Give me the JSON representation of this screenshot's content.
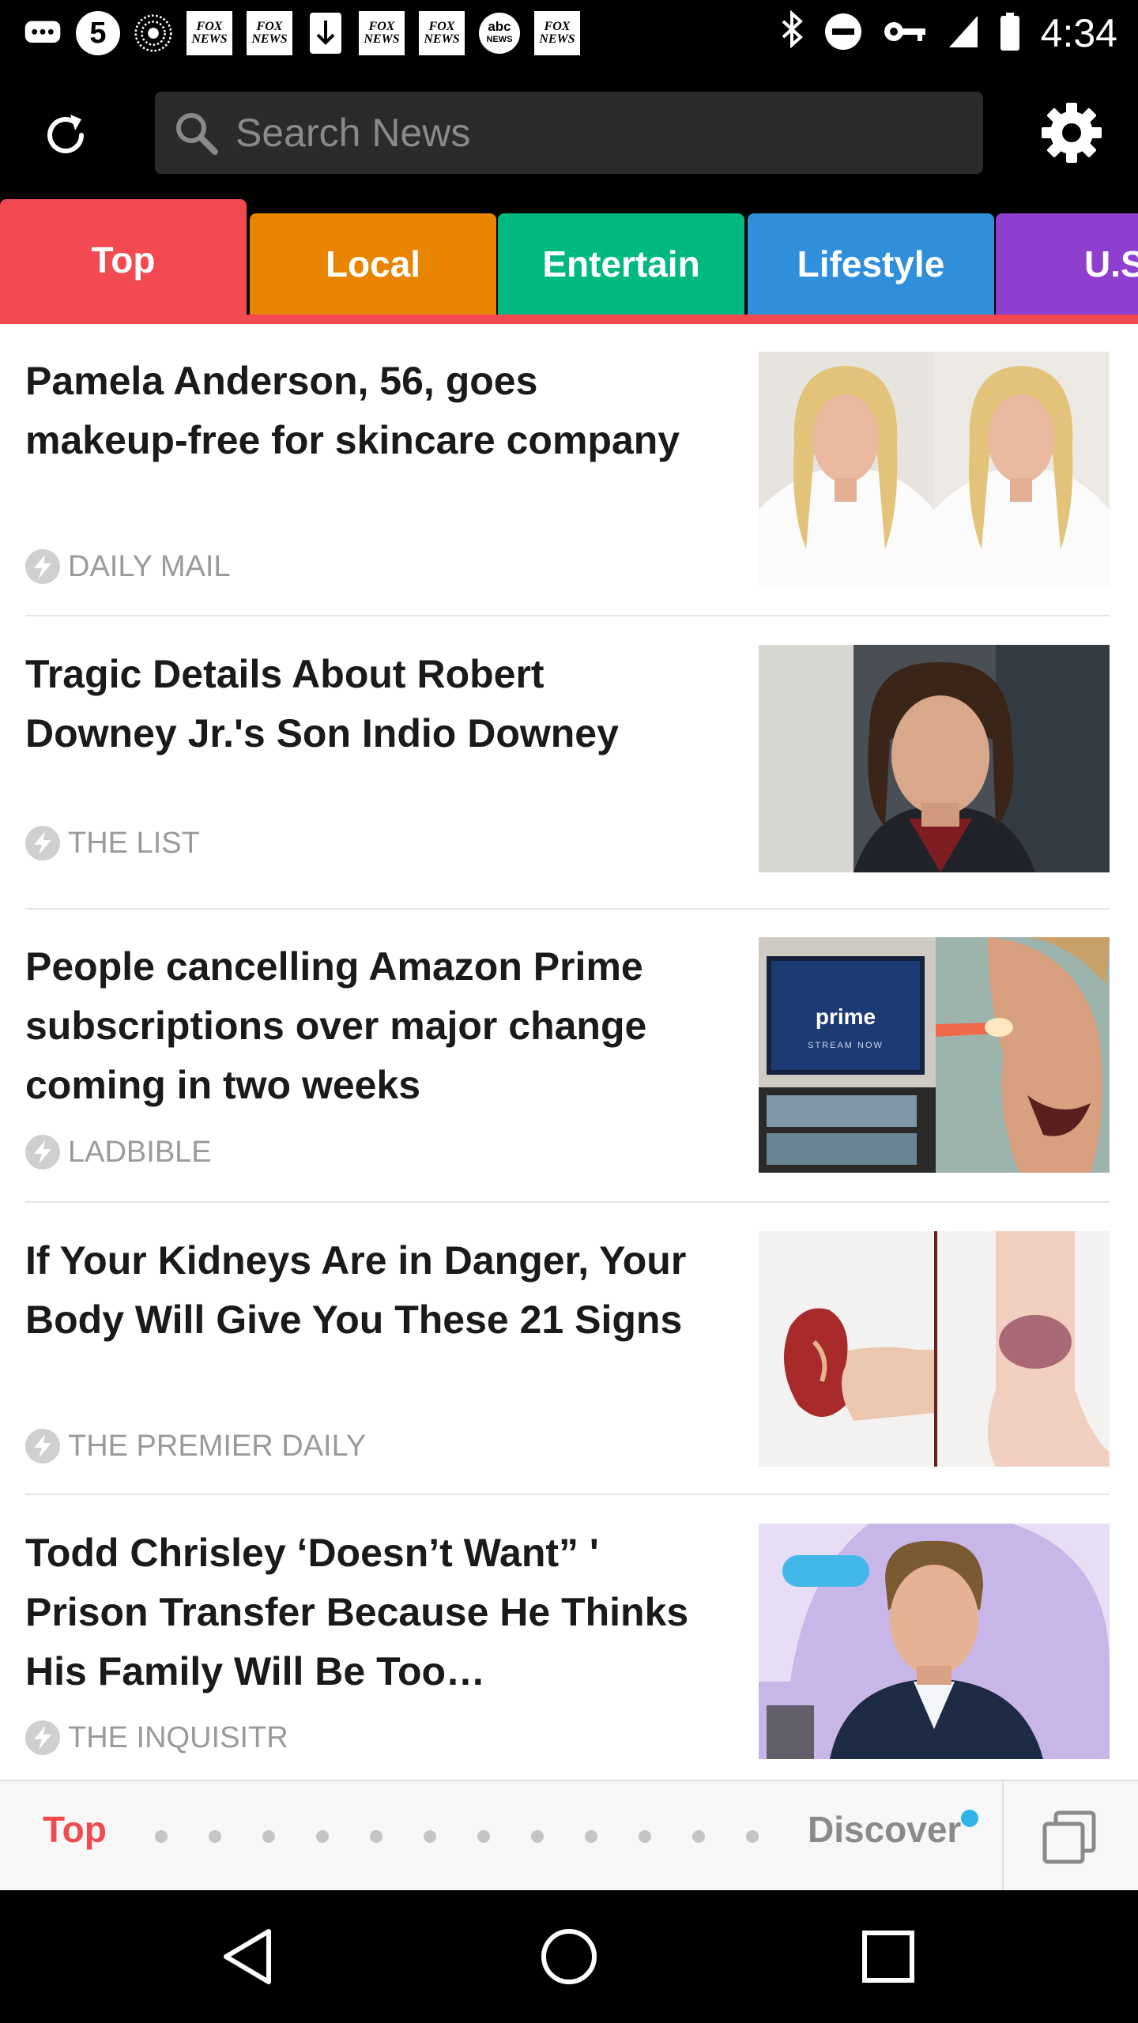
{
  "status_bar": {
    "icons": [
      "chat-icon",
      "five-icon",
      "radio-icon",
      "fox-news-icon",
      "fox-news-icon",
      "download-icon",
      "fox-news-icon",
      "fox-news-icon",
      "abc-news-icon",
      "fox-news-icon"
    ],
    "news_badge_line1": "FOX",
    "news_badge_line2": "NEWS",
    "abc_line1": "abc",
    "abc_line2": "NEWS",
    "five_label": "5",
    "time": "4:34"
  },
  "header": {
    "search_placeholder": "Search News"
  },
  "tabs": [
    {
      "label": "Top",
      "color": "#f24a50"
    },
    {
      "label": "Local",
      "color": "#e98400"
    },
    {
      "label": "Entertain",
      "color": "#00b980"
    },
    {
      "label": "Lifestyle",
      "color": "#2f8fdb"
    },
    {
      "label": "U.S",
      "color": "#8e3fd0"
    }
  ],
  "articles": [
    {
      "headline": "Pamela Anderson, 56, goes makeup-free for skincare company",
      "source": "DAILY MAIL"
    },
    {
      "headline": "Tragic Details About Robert Downey Jr.'s Son Indio Downey",
      "source": "THE LIST"
    },
    {
      "headline": "People cancelling Amazon Prime subscriptions over major change coming in two weeks",
      "source": "LADBIBLE"
    },
    {
      "headline": "If Your Kidneys Are in Danger, Your Body Will Give You These 21 Signs",
      "source": "THE PREMIER DAILY"
    },
    {
      "headline": "Todd Chrisley ‘Doesn’t Want” ' Prison Transfer Because He Thinks His Family Will Be Too…",
      "source": "THE INQUISITR"
    }
  ],
  "thumb_text": {
    "prime": "prime",
    "stream_now": "STREAM NOW"
  },
  "bottom_nav": {
    "top_label": "Top",
    "discover_label": "Discover",
    "page_dots": 12
  },
  "colors": {
    "accent": "#f24a50",
    "discover_badge": "#2fb5ea"
  }
}
